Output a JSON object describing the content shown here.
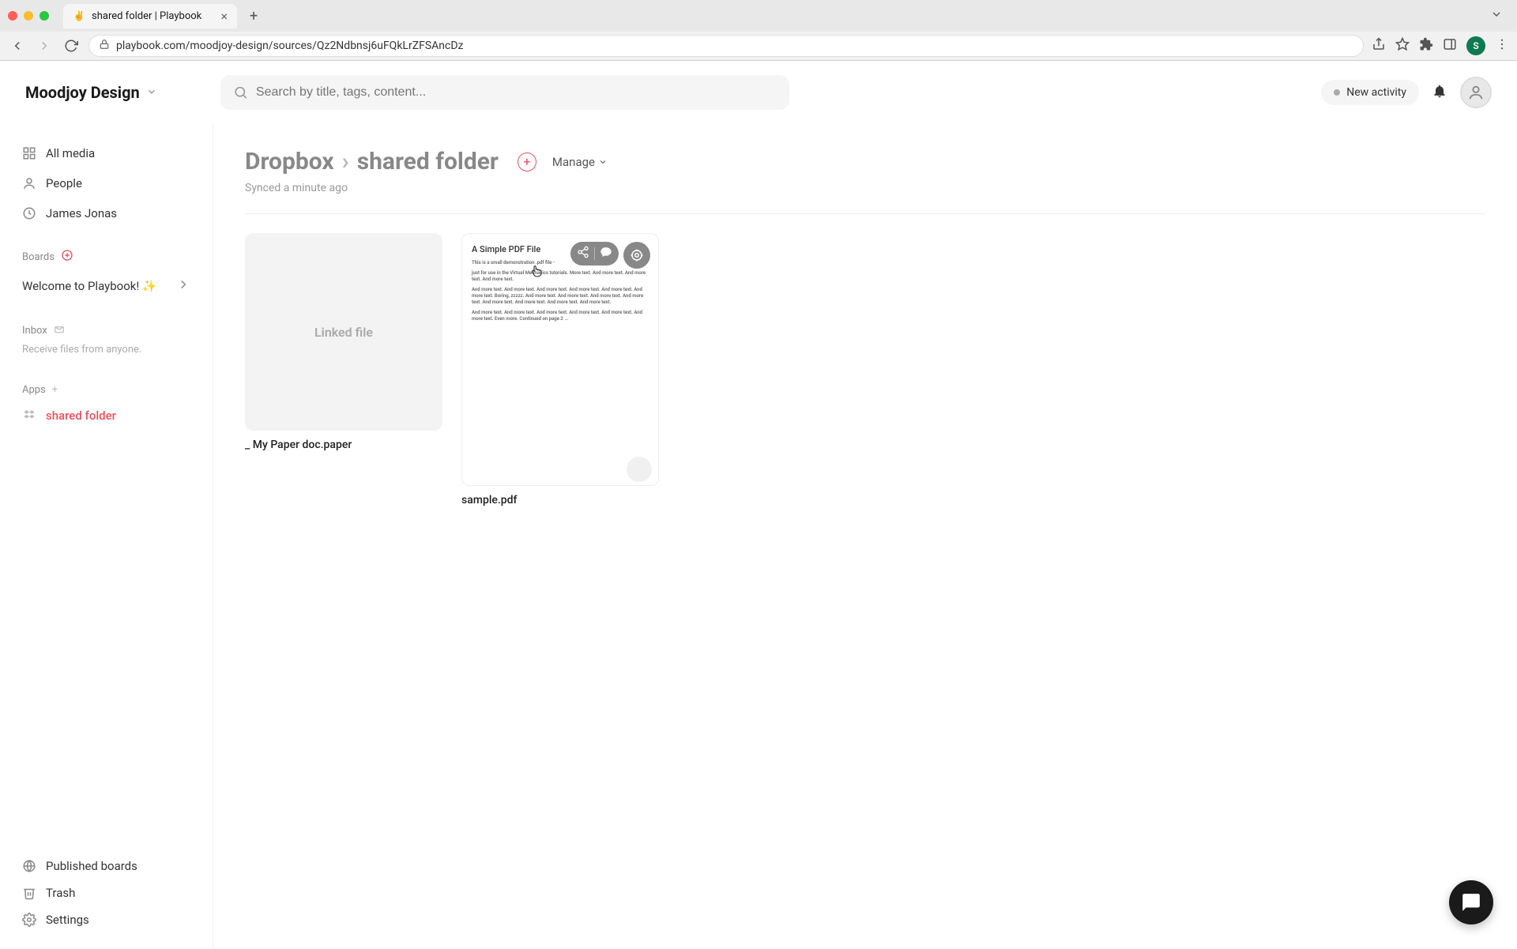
{
  "browser": {
    "tab_title": "shared folder | Playbook",
    "url": "playbook.com/moodjoy-design/sources/Qz2Ndbnsj6uFQkLrZFSAncDz",
    "avatar_letter": "S"
  },
  "header": {
    "workspace": "Moodjoy Design",
    "search_placeholder": "Search by title, tags, content...",
    "new_activity": "New activity"
  },
  "sidebar": {
    "all_media": "All media",
    "people": "People",
    "person": "James Jonas",
    "boards_label": "Boards",
    "welcome": "Welcome to Playbook! ✨",
    "inbox_label": "Inbox",
    "inbox_sub": "Receive files from anyone.",
    "apps_label": "Apps",
    "shared_folder": "shared folder",
    "published": "Published boards",
    "trash": "Trash",
    "settings": "Settings"
  },
  "main": {
    "crumb_root": "Dropbox",
    "crumb_sep": "›",
    "crumb_current": "shared folder",
    "manage": "Manage",
    "synced": "Synced a minute ago",
    "files": {
      "linked_label": "Linked file",
      "linked_name": "_ My Paper doc.paper",
      "pdf_title": "A Simple PDF File",
      "pdf_line1": "This is a small demonstration .pdf file -",
      "pdf_line2": "just for use in the Virtual Mechanics tutorials. More text. And more text. And more text. And more text.",
      "pdf_line3": "And more text. And more text. And more text. And more text. And more text. And more text. Boring, zzzzz. And more text. And more text. And more text. And more text. And more text. And more text. And more text. And more text.",
      "pdf_line4": "And more text. And more text. And more text. And more text. And more text. And more text. Even more. Continued on page 2 ...",
      "pdf_name": "sample.pdf"
    }
  }
}
